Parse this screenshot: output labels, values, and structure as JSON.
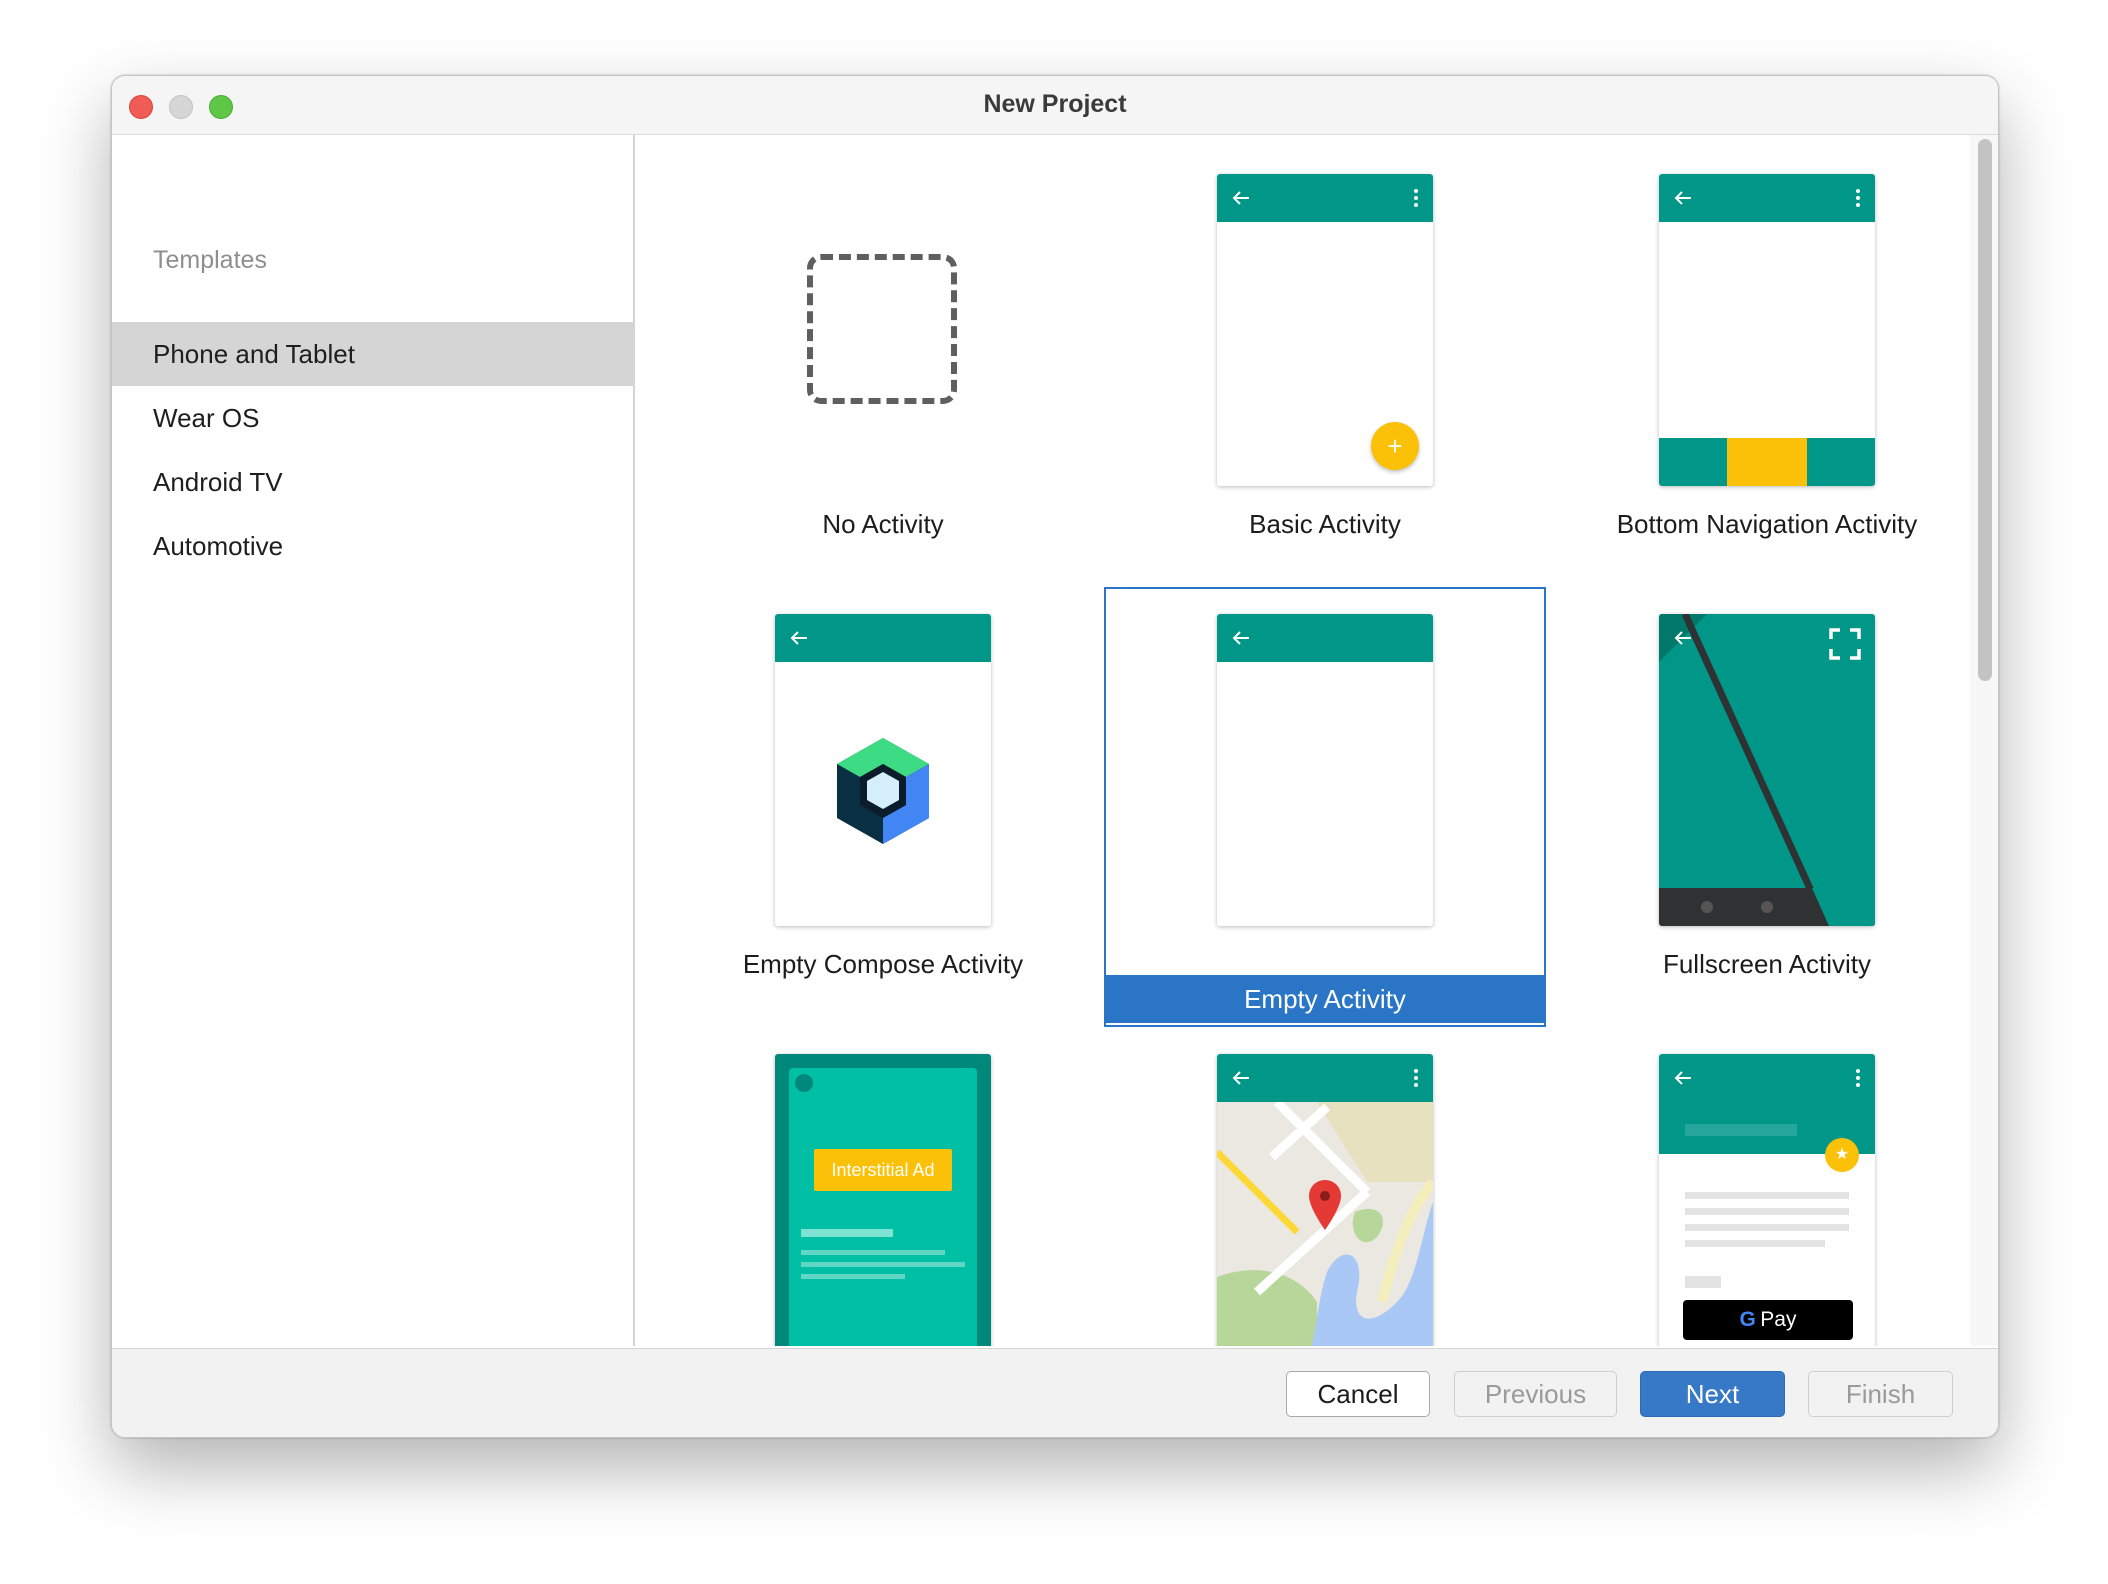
{
  "window": {
    "title": "New Project"
  },
  "sidebar": {
    "header": "Templates",
    "items": [
      {
        "label": "Phone and Tablet",
        "selected": true
      },
      {
        "label": "Wear OS",
        "selected": false
      },
      {
        "label": "Android TV",
        "selected": false
      },
      {
        "label": "Automotive",
        "selected": false
      }
    ]
  },
  "templates": [
    {
      "label": "No Activity",
      "thumbnail": "dashed-square-icon",
      "selected": false
    },
    {
      "label": "Basic Activity",
      "thumbnail": "phone-with-fab",
      "selected": false
    },
    {
      "label": "Bottom Navigation Activity",
      "thumbnail": "phone-with-bottom-nav",
      "selected": false
    },
    {
      "label": "Empty Compose Activity",
      "thumbnail": "phone-with-compose-logo",
      "selected": false
    },
    {
      "label": "Empty Activity",
      "thumbnail": "phone-empty",
      "selected": true
    },
    {
      "label": "Fullscreen Activity",
      "thumbnail": "phone-fullscreen",
      "selected": false
    },
    {
      "label": "",
      "thumbnail": "phone-interstitial-ad",
      "ad_label": "Interstitial Ad",
      "selected": false
    },
    {
      "label": "",
      "thumbnail": "phone-map",
      "selected": false
    },
    {
      "label": "",
      "thumbnail": "phone-google-pay",
      "pay_label": "Pay",
      "selected": false
    }
  ],
  "footer": {
    "cancel": "Cancel",
    "previous": "Previous",
    "next": "Next",
    "finish": "Finish"
  },
  "colors": {
    "accent": "#2a75c5",
    "app_bar": "#009688",
    "fab": "#fbc108",
    "ad_bg": "#00bfa5",
    "next_button": "#3778c7"
  }
}
